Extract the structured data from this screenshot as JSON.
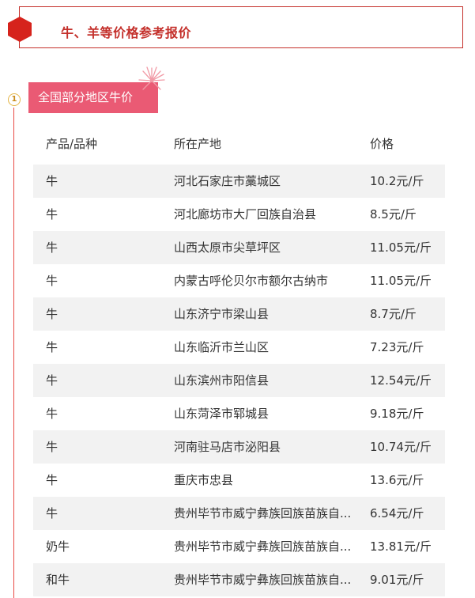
{
  "header": {
    "title": "牛、羊等价格参考报价"
  },
  "colors": {
    "accent_red": "#c4302b",
    "tag_pink": "#ea5a74",
    "badge_gold": "#e4b64a",
    "row_shade": "#f2f2f2"
  },
  "section": {
    "number": "1",
    "title": "全国部分地区牛价"
  },
  "table": {
    "columns": [
      "产品/品种",
      "所在产地",
      "价格"
    ],
    "rows": [
      [
        "牛",
        "河北石家庄市藁城区",
        "10.2元/斤"
      ],
      [
        "牛",
        "河北廊坊市大厂回族自治县",
        "8.5元/斤"
      ],
      [
        "牛",
        "山西太原市尖草坪区",
        "11.05元/斤"
      ],
      [
        "牛",
        "内蒙古呼伦贝尔市额尔古纳市",
        "11.05元/斤"
      ],
      [
        "牛",
        "山东济宁市梁山县",
        "8.7元/斤"
      ],
      [
        "牛",
        "山东临沂市兰山区",
        "7.23元/斤"
      ],
      [
        "牛",
        "山东滨州市阳信县",
        "12.54元/斤"
      ],
      [
        "牛",
        "山东菏泽市郓城县",
        "9.18元/斤"
      ],
      [
        "牛",
        "河南驻马店市泌阳县",
        "10.74元/斤"
      ],
      [
        "牛",
        "重庆市忠县",
        "13.6元/斤"
      ],
      [
        "牛",
        "贵州毕节市威宁彝族回族苗族自...",
        "6.54元/斤"
      ],
      [
        "奶牛",
        "贵州毕节市威宁彝族回族苗族自...",
        "13.81元/斤"
      ],
      [
        "和牛",
        "贵州毕节市威宁彝族回族苗族自...",
        "9.01元/斤"
      ]
    ]
  }
}
